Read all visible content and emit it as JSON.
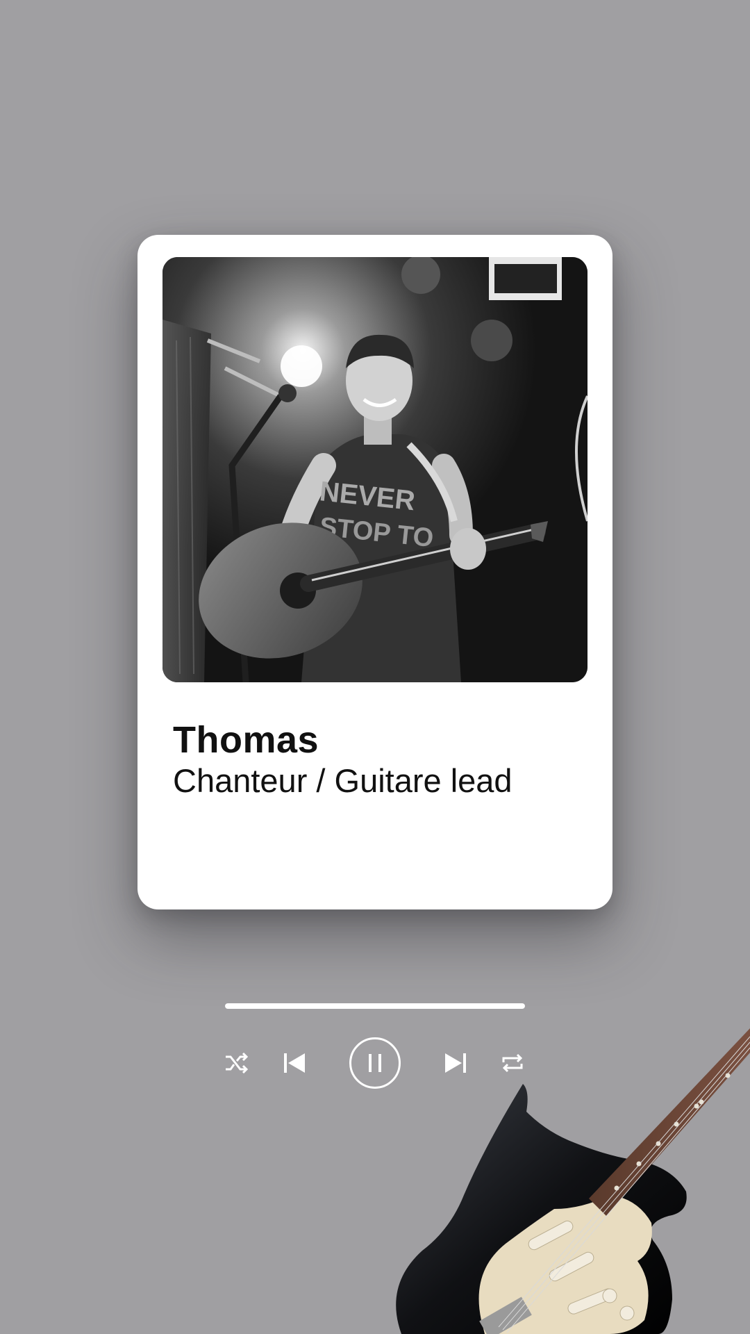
{
  "profile": {
    "name": "Thomas",
    "role": "Chanteur / Guitare lead",
    "photo_icon": "musician-photo"
  },
  "player": {
    "progress": 1.0,
    "controls": [
      {
        "id": "shuffle",
        "icon": "shuffle-icon"
      },
      {
        "id": "previous",
        "icon": "skip-previous-icon"
      },
      {
        "id": "pause",
        "icon": "pause-icon"
      },
      {
        "id": "next",
        "icon": "skip-next-icon"
      },
      {
        "id": "repeat",
        "icon": "repeat-icon"
      }
    ]
  },
  "decoration": {
    "icon": "electric-guitar"
  },
  "colors": {
    "background": "#a09fa2",
    "card": "#ffffff",
    "text": "#111111",
    "controls": "#ffffff"
  }
}
